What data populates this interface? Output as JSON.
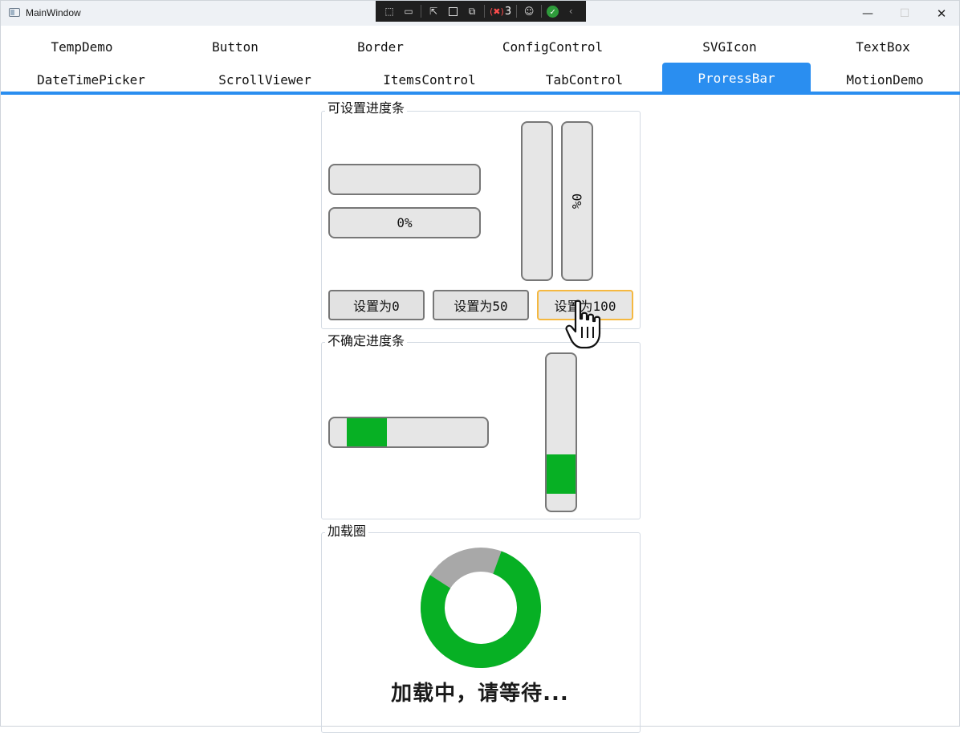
{
  "window": {
    "title": "MainWindow",
    "min_icon": "minimize-icon",
    "max_icon": "maximize-icon",
    "close_icon": "close-icon"
  },
  "debug_toolbar": {
    "error_count": "3"
  },
  "tabs": {
    "row1": [
      "TempDemo",
      "Button",
      "Border",
      "ConfigControl",
      "SVGIcon",
      "TextBox"
    ],
    "row2": [
      "DateTimePicker",
      "ScrollViewer",
      "ItemsControl",
      "TabControl",
      "ProressBar",
      "MotionDemo"
    ],
    "active": "ProressBar"
  },
  "settable_group": {
    "title": "可设置进度条",
    "h_bar_text": "0%",
    "v_bar_text": "0%",
    "value": 0,
    "buttons": [
      "设置为0",
      "设置为50",
      "设置为100"
    ]
  },
  "indeterminate_group": {
    "title": "不确定进度条"
  },
  "loading_group": {
    "title": "加载圈",
    "text": "加载中，请等待..."
  },
  "colors": {
    "accent": "#2a8ef0",
    "progress_fill": "#07b024",
    "track": "#e6e6e6",
    "ring_track": "#a8a8a8",
    "hover_border": "#f5b840"
  }
}
